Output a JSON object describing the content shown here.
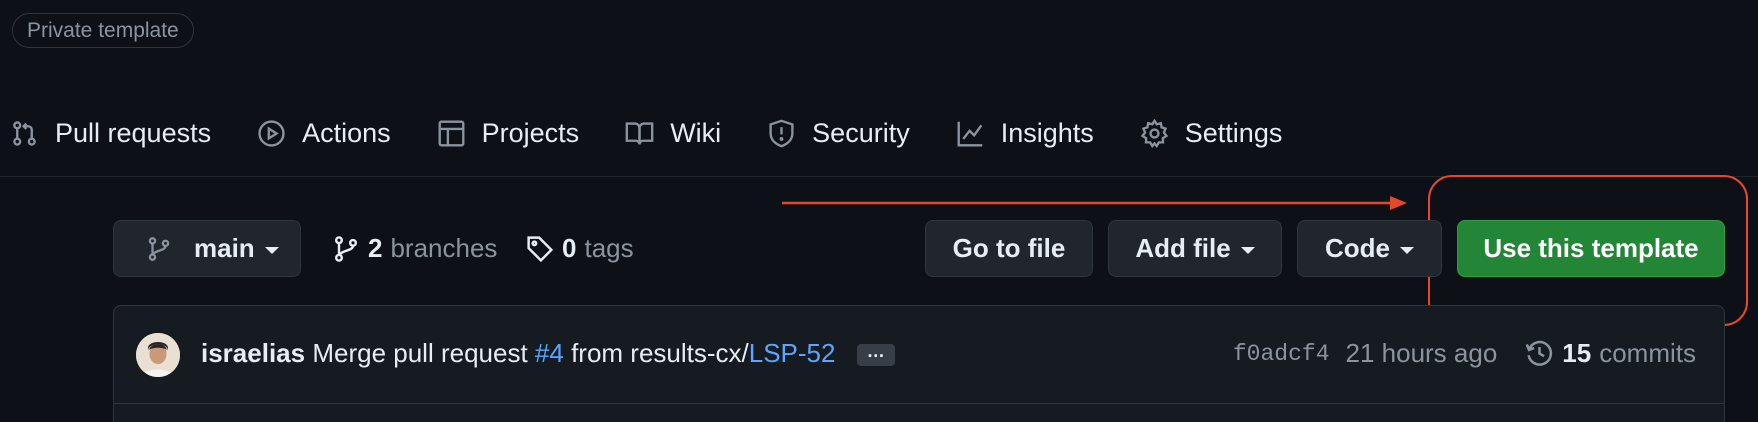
{
  "repo": {
    "visibility_badge": "Private template"
  },
  "nav": {
    "items": [
      {
        "label": "Pull requests",
        "icon": "pull-request-icon"
      },
      {
        "label": "Actions",
        "icon": "play-circle-icon"
      },
      {
        "label": "Projects",
        "icon": "table-icon"
      },
      {
        "label": "Wiki",
        "icon": "book-icon"
      },
      {
        "label": "Security",
        "icon": "shield-icon"
      },
      {
        "label": "Insights",
        "icon": "graph-icon"
      },
      {
        "label": "Settings",
        "icon": "gear-icon"
      }
    ]
  },
  "toolbar": {
    "branch_label": "main",
    "branches_count": "2",
    "branches_label": "branches",
    "tags_count": "0",
    "tags_label": "tags",
    "go_to_file": "Go to file",
    "add_file": "Add file",
    "code": "Code",
    "use_template": "Use this template"
  },
  "commit": {
    "author": "israelias",
    "message_prefix": "Merge pull request",
    "pr_link": "#4",
    "message_mid": "from results-cx/",
    "branch_link": "LSP-52",
    "ellipsis": "…",
    "sha": "f0adcf4",
    "time": "21 hours ago",
    "commits_count": "15",
    "commits_label": "commits"
  },
  "colors": {
    "background": "#0d1117",
    "primary_button": "#238636",
    "link": "#58a6ff",
    "annotation": "#e5482a"
  }
}
